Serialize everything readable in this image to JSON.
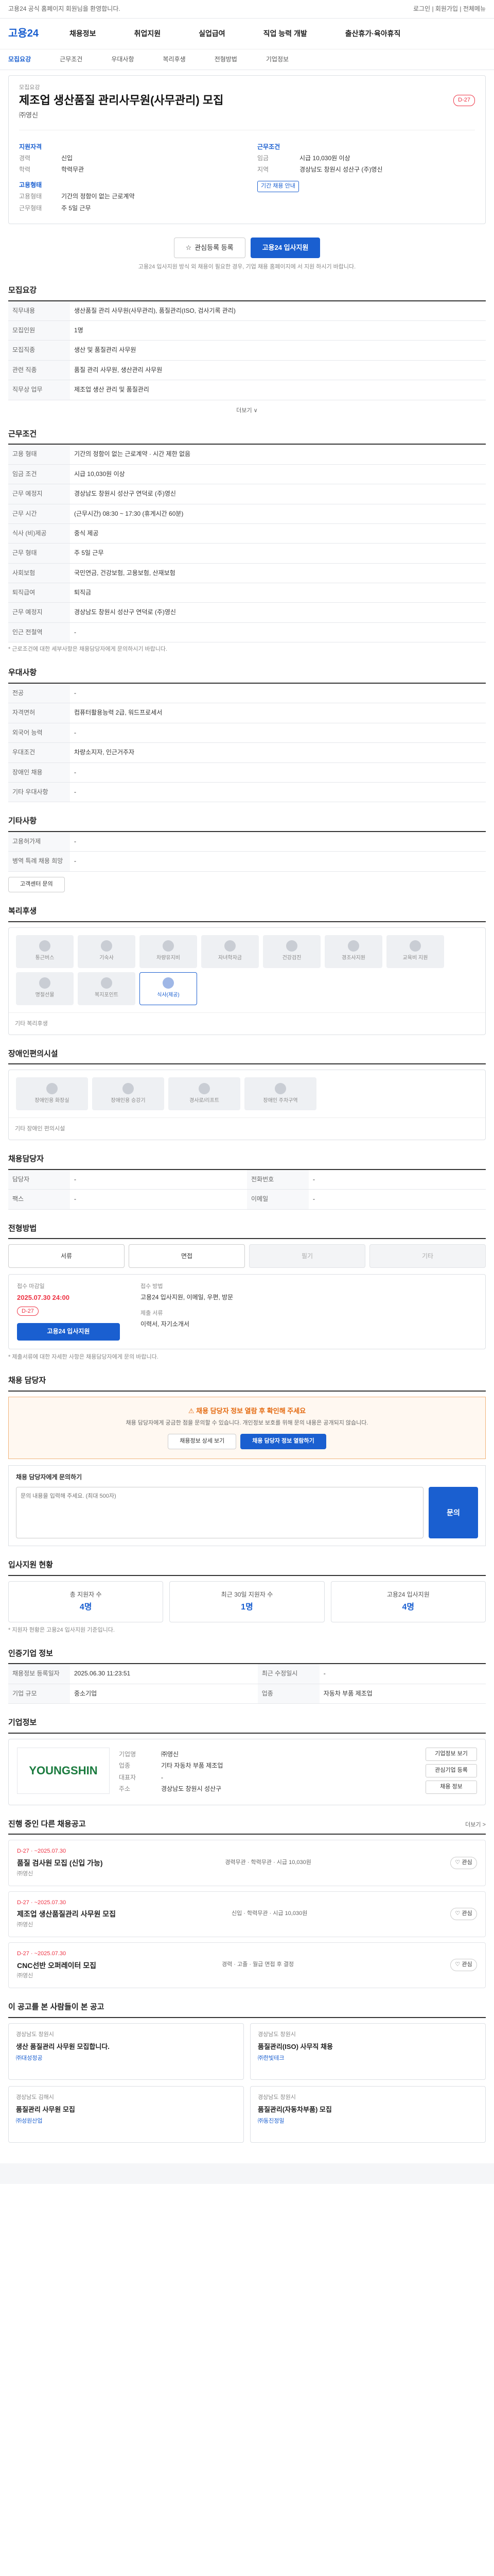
{
  "top": {
    "notice": "고용24 공식 홈페이지 회원님을 환영합니다.",
    "right": "로그인 | 회원가입 | 전체메뉴"
  },
  "brand": {
    "logo": "고용24"
  },
  "gnb": [
    "채용정보",
    "취업지원",
    "실업급여",
    "직업 능력 개발",
    "출산휴가·육아휴직"
  ],
  "lnb": [
    "모집요강",
    "근무조건",
    "우대사항",
    "복리후생",
    "전형방법",
    "기업정보"
  ],
  "head": {
    "label": "모집요강",
    "title": "제조업 생산품질 관리사무원(사무관리) 모집",
    "company": "㈜영신",
    "dday": "D-27",
    "left_header": "지원자격",
    "left": [
      {
        "k": "경력",
        "v": "신입"
      },
      {
        "k": "학력",
        "v": "학력무관"
      }
    ],
    "right_header": "근무조건",
    "right": [
      {
        "k": "임금",
        "v": "시급 10,030원 이상"
      },
      {
        "k": "지역",
        "v": "경상남도 창원시 성산구 (주)영신"
      }
    ],
    "third_header": "고용형태",
    "third": [
      {
        "k": "고용형태",
        "v": "기간의 정함이 없는 근로계약"
      },
      {
        "k": "근무형태",
        "v": "주 5일 근무"
      }
    ],
    "badge": "기간 채용 안내"
  },
  "buttons": {
    "scrap": "관심등록 등록",
    "apply": "고용24 입사지원"
  },
  "notice_apply": "고용24 입사지원 방식 외 채용이 필요한 경우, 기업 채용 홈페이지에 서 지원 하시기 바랍니다.",
  "job": {
    "title": "모집요강",
    "rows": [
      {
        "k": "직무내용",
        "v": "생산품질 관리 사무원(사무관리), 품질관리(ISO, 검사기록 관리)"
      },
      {
        "k": "모집인원",
        "v": "1명"
      },
      {
        "k": "모집직종",
        "v": "생산 및 품질관리 사무원"
      },
      {
        "k": "관련 직종",
        "v": "품질 관리 사무원, 생산관리 사무원"
      },
      {
        "k": "직무상 업무",
        "v": "제조업 생산 관리 및 품질관리"
      }
    ],
    "more_btn": "더보기 ∨"
  },
  "conditions": {
    "title": "근무조건",
    "rows": [
      {
        "k": "고용 형태",
        "v": "기간의 정함이 없는 근로계약 · 시간 제한 없음"
      },
      {
        "k": "임금 조건",
        "v": "시급 10,030원 이상"
      },
      {
        "k": "근무 예정지",
        "v": "경상남도 창원시 성산구 연덕로 (주)영신"
      },
      {
        "k": "근무 시간",
        "v": "(근무시간) 08:30 ~ 17:30 (휴게시간 60분)"
      },
      {
        "k": "식사 (비)제공",
        "v": "중식 제공"
      },
      {
        "k": "근무 형태",
        "v": "주 5일 근무"
      },
      {
        "k": "사회보험",
        "v": "국민연금, 건강보험, 고용보험, 산재보험"
      },
      {
        "k": "퇴직급여",
        "v": "퇴직금"
      },
      {
        "k": "근무 예정지",
        "v": "경상남도 창원시 성산구 연덕로 (주)영신"
      },
      {
        "k": "인근 전철역",
        "v": "-"
      }
    ],
    "note": "* 근로조건에 대한 세부사항은 채용담당자에게 문의하시기 바랍니다."
  },
  "prefer": {
    "title": "우대사항",
    "rows": [
      {
        "k": "전공",
        "v": "-"
      },
      {
        "k": "자격면허",
        "v": "컴퓨터활용능력 2급, 워드프로세서"
      },
      {
        "k": "외국어 능력",
        "v": "-"
      },
      {
        "k": "우대조건",
        "v": "차량소지자, 인근거주자"
      },
      {
        "k": "장애인 채용",
        "v": "-"
      },
      {
        "k": "기타 우대사항",
        "v": "-"
      }
    ]
  },
  "etc": {
    "title": "기타사항",
    "rows": [
      {
        "k": "고용허가제",
        "v": "-"
      },
      {
        "k": "병역 특례 채용 희망",
        "v": "-"
      }
    ],
    "link": "고객센터 문의"
  },
  "welfare": {
    "title": "복리후생",
    "items": [
      "통근버스",
      "기숙사",
      "차량유지비",
      "자녀학자금",
      "건강검진",
      "경조사지원",
      "교육비 지원",
      "명절선물",
      "복지포인트",
      "식사(제공)"
    ],
    "selected_index": 9,
    "etc_label": "기타 복리후생"
  },
  "disabled": {
    "title": "장애인편의시설",
    "items": [
      "장애인용 화장실",
      "장애인용 승강기",
      "경사로/리프트",
      "장애인 주차구역"
    ],
    "etc_label": "기타 장애인 편의시설"
  },
  "contact": {
    "title": "채용담당자",
    "rows": [
      {
        "k": "담당자",
        "v": "-"
      },
      {
        "k": "전화번호",
        "v": "-"
      },
      {
        "k": "팩스",
        "v": "-"
      },
      {
        "k": "이메일",
        "v": "-"
      }
    ]
  },
  "process": {
    "title": "전형방법",
    "methods": [
      "서류",
      "면접",
      "필기",
      "기타"
    ],
    "method_state": [
      true,
      true,
      false,
      false
    ],
    "deadline_label": "접수 마감일",
    "deadline": "2025.07.30 24:00",
    "dday": "D-27",
    "method_label": "접수 방법",
    "method_text": "고용24 입사지원, 이메일, 우편, 방문",
    "apply_btn": "고용24 입사지원",
    "docs_label": "제출 서류",
    "docs": "이력서, 자기소개서",
    "note": "* 제출서류에 대한 자세한 사항은 채용담당자에게 문의 바랍니다."
  },
  "inquiry": {
    "title": "채용 담당자",
    "alert": "채용 담당자 정보 열람 후 확인해 주세요",
    "text": "채용 담당자에게 궁금한 점을 문의할 수 있습니다. 개인정보 보호를 위해 문의 내용은 공개되지 않습니다.",
    "btn_left": "채용정보 상세 보기",
    "btn_right": "채용 담당자 정보 열람하기",
    "form_label": "채용 담당자에게 문의하기",
    "placeholder": "문의 내용을 입력해 주세요. (최대 500자)",
    "send": "문의"
  },
  "status": {
    "title": "입사지원 현황",
    "items": [
      {
        "label": "총 지원자 수",
        "value": "4명"
      },
      {
        "label": "최근 30일 지원자 수",
        "value": "1명"
      },
      {
        "label": "고용24 입사지원",
        "value": "4명"
      }
    ],
    "note": "* 지원자 현황은 고용24 입사지원 기준입니다."
  },
  "info": {
    "title": "인증기업 정보",
    "rows": [
      {
        "k": "채용정보 등록일자",
        "v": "2025.06.30 11:23:51"
      },
      {
        "k": "최근 수정일시",
        "v": "-"
      },
      {
        "k": "기업 규모",
        "v": "중소기업"
      },
      {
        "k": "업종",
        "v": "자동차 부품 제조업"
      }
    ]
  },
  "company": {
    "title": "기업정보",
    "logo_text": "YOUNGSHIN",
    "rows": [
      {
        "k": "기업명",
        "v": "㈜영신"
      },
      {
        "k": "업종",
        "v": "기타 자동차 부품 제조업"
      },
      {
        "k": "대표자",
        "v": "-"
      },
      {
        "k": "주소",
        "v": "경상남도 창원시 성산구"
      }
    ],
    "side_buttons": [
      "기업정보 보기",
      "관심기업 등록",
      "채용 정보"
    ]
  },
  "jobs": {
    "title": "진행 중인 다른 채용공고",
    "more": "더보기 >",
    "items": [
      {
        "date": "D-27 · ~2025.07.30",
        "title": "품질 검사원 모집 (신입 가능)",
        "company": "㈜영신",
        "cond": "경력무관 · 학력무관 · 시급 10,030원",
        "fav": "관심"
      },
      {
        "date": "D-27 · ~2025.07.30",
        "title": "제조업 생산품질관리 사무원 모집",
        "company": "㈜영신",
        "cond": "신입 · 학력무관 · 시급 10,030원",
        "fav": "관심"
      },
      {
        "date": "D-27 · ~2025.07.30",
        "title": "CNC선반 오퍼레이터 모집",
        "company": "㈜영신",
        "cond": "경력 · 고졸 · 월급 면접 후 결정",
        "fav": "관심"
      }
    ]
  },
  "recommend": {
    "title": "이 공고를 본 사람들이 본 공고",
    "items": [
      {
        "h": "경상남도 창원시",
        "t": "생산 품질관리 사무원 모집합니다.",
        "c": "㈜대성정공"
      },
      {
        "h": "경상남도 창원시",
        "t": "품질관리(ISO) 사무직 채용",
        "c": "㈜한빛테크"
      },
      {
        "h": "경상남도 김해시",
        "t": "품질관리 사무원 모집",
        "c": "㈜성원산업"
      },
      {
        "h": "경상남도 창원시",
        "t": "품질관리(자동차부품) 모집",
        "c": "㈜동진정밀"
      }
    ]
  },
  "colors": {
    "accent": "#1a5fd0",
    "danger": "#e34",
    "warn": "#e46b12"
  }
}
